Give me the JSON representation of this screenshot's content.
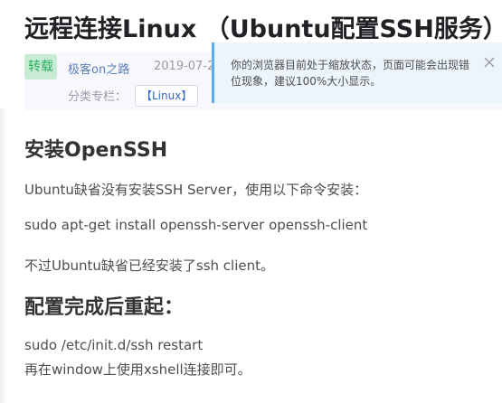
{
  "article": {
    "title": "远程连接Linux （Ubuntu配置SSH服务）",
    "badge": "转载",
    "author": "极客on之路",
    "date": "2019-07-2",
    "category_label": "分类专栏：",
    "category_tag": "【Linux】"
  },
  "notice": {
    "text": "你的浏览器目前处于缩放状态，页面可能会出现错位现象，建议100%大小显示。",
    "close_icon": "close-icon"
  },
  "content": {
    "heading1": "安装OpenSSH",
    "p1": "Ubuntu缺省没有安装SSH Server，使用以下命令安装：",
    "p2": "sudo apt-get install openssh-server openssh-client",
    "p3": "不过Ubuntu缺省已经安装了ssh client。",
    "heading2": "配置完成后重起：",
    "p4": "sudo /etc/init.d/ssh restart",
    "p5": "再在window上使用xshell连接即可。"
  },
  "colors": {
    "badge_bg": "#c8ecd3",
    "badge_text": "#27b061",
    "author": "#5a7fb8",
    "notice_bg": "#edf5fc",
    "notice_border": "#5aaef0",
    "tag_text": "#3366cc"
  }
}
